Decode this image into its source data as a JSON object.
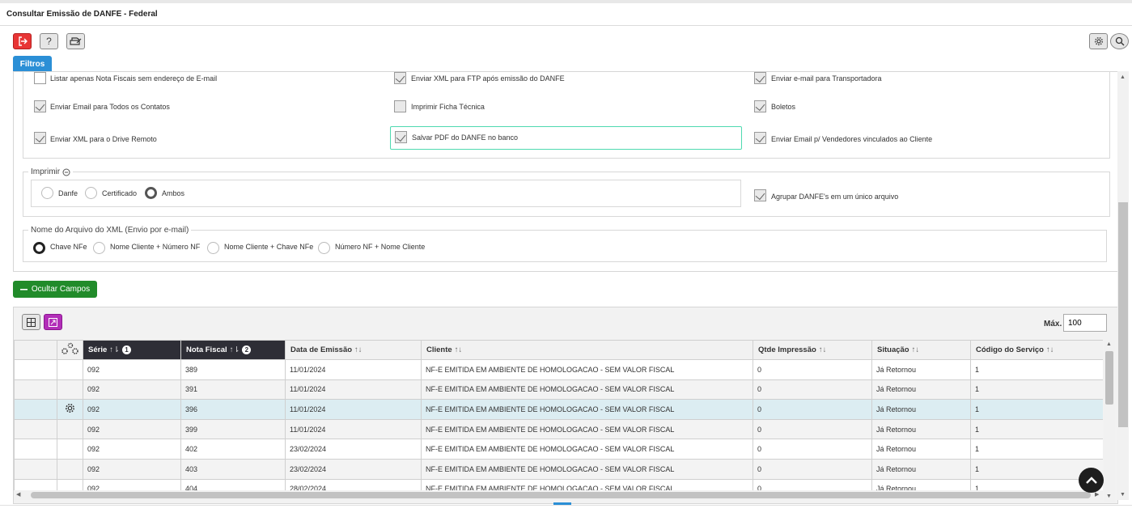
{
  "title": "Consultar Emissão de DANFE - Federal",
  "toolbar": {
    "exit_icon": "exit-icon",
    "help_icon": "question-icon",
    "print_icon": "printer-icon",
    "settings_icon": "gear-icon",
    "search_icon": "search-icon"
  },
  "tab_filtros": "Filtros",
  "checkboxes": [
    {
      "label": "Listar apenas Nota Fiscais sem endereço de E-mail",
      "checked": false
    },
    {
      "label": "Enviar XML para FTP após emissão do DANFE",
      "checked": true
    },
    {
      "label": "Enviar e-mail para Transportadora",
      "checked": true
    },
    {
      "label": "Enviar Email para Todos os Contatos",
      "checked": true
    },
    {
      "label": "Imprimir Ficha Técnica",
      "checked": false
    },
    {
      "label": "Boletos",
      "checked": true
    },
    {
      "label": "Enviar XML para o Drive Remoto",
      "checked": true
    },
    {
      "label": "Salvar PDF do DANFE no banco",
      "checked": true
    },
    {
      "label": "Enviar Email p/ Vendedores vinculados ao Cliente",
      "checked": true
    }
  ],
  "imprimir": {
    "legend": "Imprimir",
    "options": [
      "Danfe",
      "Certificado",
      "Ambos"
    ],
    "selected": "Ambos"
  },
  "agrupar_label": "Agrupar DANFE's em um único arquivo",
  "nome_arquivo": {
    "legend": "Nome do Arquivo do XML (Envio por e-mail)",
    "options": [
      "Chave NFe",
      "Nome Cliente + Número NF",
      "Nome Cliente + Chave NFe",
      "Número NF + Nome Cliente"
    ],
    "selected": "Chave NFe"
  },
  "ocultar_campos": "Ocultar Campos",
  "max_label": "Máx.",
  "max_value": "100",
  "table": {
    "columns": [
      {
        "label": "Série",
        "sort_order": "1"
      },
      {
        "label": "Nota Fiscal",
        "sort_order": "2"
      },
      {
        "label": "Data de Emissão"
      },
      {
        "label": "Cliente"
      },
      {
        "label": "Qtde Impressão"
      },
      {
        "label": "Situação"
      },
      {
        "label": "Código do Serviço"
      }
    ],
    "rows": [
      {
        "serie": "092",
        "nota": "389",
        "data": "11/01/2024",
        "cliente": "NF-E EMITIDA EM AMBIENTE DE HOMOLOGACAO - SEM VALOR FISCAL",
        "qtde": "0",
        "situacao": "Já Retornou",
        "codigo": "1"
      },
      {
        "serie": "092",
        "nota": "391",
        "data": "11/01/2024",
        "cliente": "NF-E EMITIDA EM AMBIENTE DE HOMOLOGACAO - SEM VALOR FISCAL",
        "qtde": "0",
        "situacao": "Já Retornou",
        "codigo": "1"
      },
      {
        "serie": "092",
        "nota": "396",
        "data": "11/01/2024",
        "cliente": "NF-E EMITIDA EM AMBIENTE DE HOMOLOGACAO - SEM VALOR FISCAL",
        "qtde": "0",
        "situacao": "Já Retornou",
        "codigo": "1"
      },
      {
        "serie": "092",
        "nota": "399",
        "data": "11/01/2024",
        "cliente": "NF-E EMITIDA EM AMBIENTE DE HOMOLOGACAO - SEM VALOR FISCAL",
        "qtde": "0",
        "situacao": "Já Retornou",
        "codigo": "1"
      },
      {
        "serie": "092",
        "nota": "402",
        "data": "23/02/2024",
        "cliente": "NF-E EMITIDA EM AMBIENTE DE HOMOLOGACAO - SEM VALOR FISCAL",
        "qtde": "0",
        "situacao": "Já Retornou",
        "codigo": "1"
      },
      {
        "serie": "092",
        "nota": "403",
        "data": "23/02/2024",
        "cliente": "NF-E EMITIDA EM AMBIENTE DE HOMOLOGACAO - SEM VALOR FISCAL",
        "qtde": "0",
        "situacao": "Já Retornou",
        "codigo": "1"
      },
      {
        "serie": "092",
        "nota": "404",
        "data": "28/02/2024",
        "cliente": "NF-E EMITIDA EM AMBIENTE DE HOMOLOGACAO - SEM VALOR FISCAL",
        "qtde": "0",
        "situacao": "Já Retornou",
        "codigo": "1"
      }
    ],
    "active_row": 2
  }
}
